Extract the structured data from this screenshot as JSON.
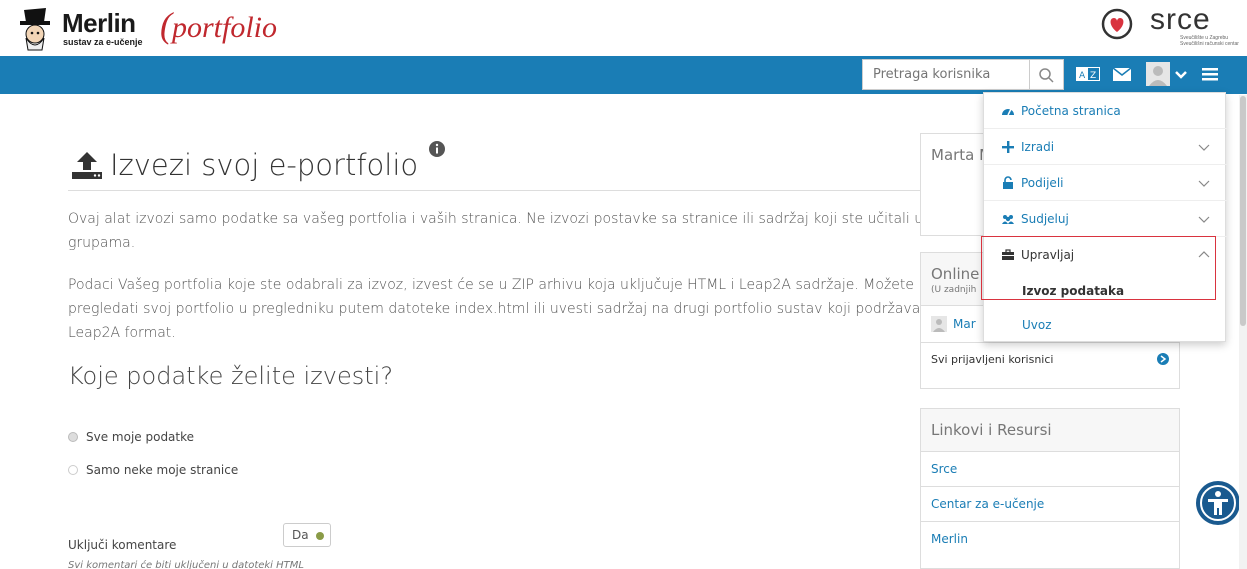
{
  "header": {
    "brand": "Merlin",
    "brand_sub": "sustav za e-učenje",
    "portfolio_logo": "portfolio",
    "partner": "srce",
    "partner_sub": "Sveučilište u Zagrebu Sveučilišni računski centar"
  },
  "navbar": {
    "search_placeholder": "Pretraga korisnika",
    "icons": [
      "search-icon",
      "language-icon",
      "mail-icon",
      "user-avatar-icon",
      "chevron-down-icon",
      "menu-icon"
    ]
  },
  "page": {
    "title": "Izvezi svoj e-portfolio",
    "intro": "Ovaj alat izvozi samo podatke sa vašeg portfolia i vaših stranica. Ne izvozi postavke sa stranice ili sadržaj koji ste učitali u grupama.",
    "details": "Podaci Vašeg portfolia koje ste odabrali za izvoz, izvest će se u ZIP arhivu koja uključuje HTML i Leap2A sadržaje. Možete pregledati svoj portfolio u pregledniku putem datoteke index.html ili uvesti sadržaj na drugi portfolio sustav koji podržava Leap2A format.",
    "question": "Koje podatke želite izvesti?",
    "options": [
      "Sve moje podatke",
      "Samo neke moje stranice"
    ],
    "include_comments_label": "Uključi komentare",
    "include_comments_value": "Da",
    "help": "Svi komentari će biti uključeni u datoteki HTML"
  },
  "sidebar": {
    "user_name": "Marta M",
    "online_title": "Online",
    "online_sub": "(U zadnjih",
    "online_user": "Mar",
    "all_users": "Svi prijavljeni korisnici",
    "links_title": "Linkovi i Resursi",
    "links": [
      "Srce",
      "Centar za e-učenje",
      "Merlin"
    ]
  },
  "menu": {
    "items": [
      {
        "label": "Početna stranica",
        "icon": "dashboard-icon"
      },
      {
        "label": "Izradi",
        "icon": "plus-icon"
      },
      {
        "label": "Podijeli",
        "icon": "lock-icon"
      },
      {
        "label": "Sudjeluj",
        "icon": "users-icon"
      },
      {
        "label": "Upravljaj",
        "icon": "briefcase-icon"
      }
    ],
    "sub_items": [
      "Izvoz podataka",
      "Uvoz"
    ]
  },
  "colors": {
    "navbar": "#1a7db5",
    "link": "#1a7db5",
    "highlight": "#d9333f"
  }
}
